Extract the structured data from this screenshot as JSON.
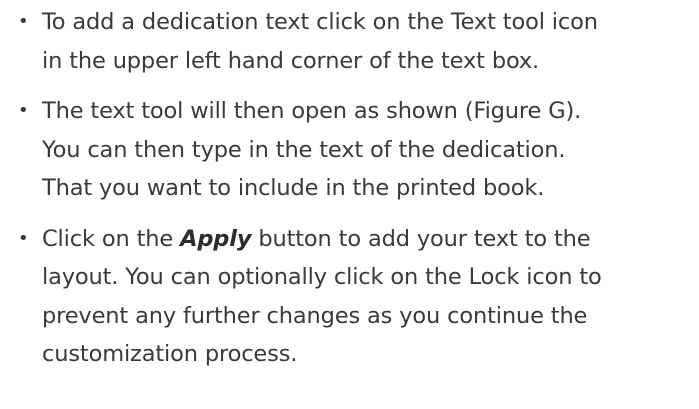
{
  "bullets": [
    {
      "lines": [
        "To add a dedication text click on the Text tool icon",
        "in the upper left hand corner of the text box."
      ]
    },
    {
      "lines": [
        "The text tool will then open as shown (Figure G).",
        "You can then type in the text of the dedication.",
        "That you want to include in the printed book."
      ]
    },
    {
      "line1_before": "Click on the ",
      "line1_emph": "Apply",
      "line1_after": " button to add your text to the",
      "lines_rest": [
        "layout. You can optionally click on the Lock icon to",
        "prevent any further changes as you continue the",
        "customization process."
      ]
    }
  ],
  "bullet_glyph": "•"
}
